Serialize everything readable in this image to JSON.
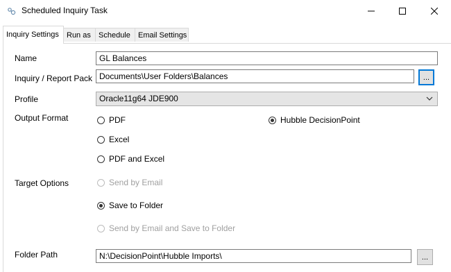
{
  "window": {
    "title": "Scheduled Inquiry Task",
    "minimize_icon": "minimize-icon",
    "maximize_icon": "maximize-icon",
    "close_icon": "close-icon"
  },
  "tabs": [
    {
      "label": "Inquiry Settings",
      "active": true
    },
    {
      "label": "Run as",
      "active": false
    },
    {
      "label": "Schedule",
      "active": false
    },
    {
      "label": "Email Settings",
      "active": false
    }
  ],
  "form": {
    "name": {
      "label": "Name",
      "value": "GL Balances"
    },
    "pack": {
      "label": "Inquiry / Report Pack",
      "value": "Documents\\User Folders\\Balances",
      "browse": "..."
    },
    "profile": {
      "label": "Profile",
      "value": "Oracle11g64 JDE900"
    },
    "output_format": {
      "label": "Output Format",
      "options": [
        {
          "label": "PDF",
          "checked": false
        },
        {
          "label": "Excel",
          "checked": false
        },
        {
          "label": "PDF and Excel",
          "checked": false
        },
        {
          "label": "Hubble DecisionPoint",
          "checked": true
        }
      ]
    },
    "target_options": {
      "label": "Target Options",
      "options": [
        {
          "label": "Send by Email",
          "checked": false,
          "enabled": false
        },
        {
          "label": "Save to Folder",
          "checked": true,
          "enabled": true
        },
        {
          "label": "Send by Email and Save to Folder",
          "checked": false,
          "enabled": false
        }
      ]
    },
    "folder_path": {
      "label": "Folder Path",
      "value": "N:\\DecisionPoint\\Hubble Imports\\",
      "browse": "..."
    }
  },
  "colors": {
    "focus_border": "#0078d7",
    "tab_bg": "#f0f0f0"
  }
}
